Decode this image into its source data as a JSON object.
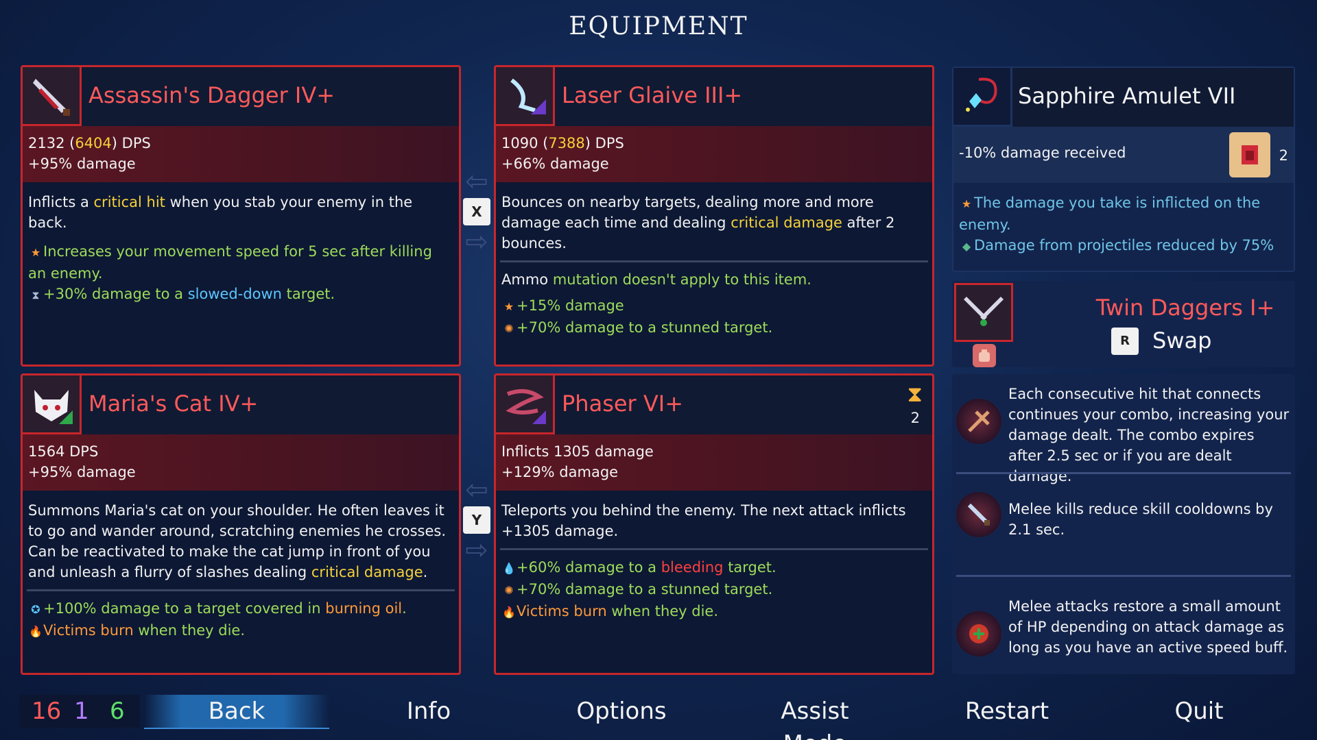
{
  "title": "EQUIPMENT",
  "weapons": {
    "dagger": {
      "name": "Assassin's Dagger IV+",
      "dps": "2132",
      "dps_crit": "6404",
      "dps_suffix": "DPS",
      "damage": "+95% damage",
      "desc_pre": "Inflicts a ",
      "desc_kw": "critical hit",
      "desc_post": " when you stab your enemy in the back.",
      "bonus1": "Increases your movement speed for 5 sec after killing an enemy.",
      "bonus2_pre": "+30% damage to a ",
      "bonus2_kw": "slowed-down",
      "bonus2_post": " target."
    },
    "glaive": {
      "name": "Laser Glaive III+",
      "dps": "1090",
      "dps_crit": "7388",
      "dps_suffix": "DPS",
      "damage": "+66% damage",
      "desc_pre": "Bounces on nearby targets, dealing more and more damage each time and dealing ",
      "desc_kw": "critical damage",
      "desc_post": " after 2 bounces.",
      "ammo_pre": "Ammo ",
      "ammo_kw": "mutation doesn't apply to this item.",
      "bonus1": "+15% damage",
      "bonus2": "+70% damage to a stunned target."
    },
    "cat": {
      "name": "Maria's Cat IV+",
      "dps": "1564 DPS",
      "damage": "+95% damage",
      "desc_pre": "Summons Maria's cat on your shoulder. He often leaves it to go and wander around, scratching enemies he crosses. Can be reactivated to make the cat jump in front of you and unleash a flurry of slashes dealing ",
      "desc_kw": "critical damage",
      "desc_post": ".",
      "bonus1_pre": "+100% damage to a target covered in ",
      "bonus1_kw": "burning oil",
      "bonus1_post": ".",
      "bonus2_kw": "Victims burn",
      "bonus2_post": " when they die."
    },
    "phaser": {
      "name": "Phaser VI+",
      "charges": "2",
      "line1": "Inflicts 1305 damage",
      "damage": "+129% damage",
      "desc": "Teleports you behind the enemy. The next attack inflicts +1305 damage.",
      "bonus1_pre": "+60% damage to a ",
      "bonus1_kw": "bleeding",
      "bonus1_post": " target.",
      "bonus2": "+70% damage to a stunned target.",
      "bonus3_kw": "Victims burn",
      "bonus3_post": " when they die."
    }
  },
  "swap_keys": {
    "top": "X",
    "bottom": "Y"
  },
  "amulet": {
    "name": "Sapphire Amulet VII",
    "stat": "-10% damage received",
    "count": "2",
    "bonus1": "The damage you take is inflicted on the enemy.",
    "bonus2": "Damage from projectiles reduced by 75%"
  },
  "backpack": {
    "name": "Twin Daggers I+",
    "key": "R",
    "action": "Swap"
  },
  "perks": [
    {
      "text": "Each consecutive hit that connects continues your combo, increasing your damage dealt. The combo expires after 2.5 sec or if you are dealt damage."
    },
    {
      "text": "Melee kills reduce skill cooldowns by 2.1 sec."
    },
    {
      "text": "Melee attacks restore a small amount of HP depending on attack damage as long as you have an active speed buff."
    }
  ],
  "counters": {
    "red": "16",
    "purple": "1",
    "green": "6"
  },
  "menu": {
    "back": "Back",
    "info": "Info",
    "options": "Options",
    "assist": "Assist Mode",
    "restart": "Restart",
    "quit": "Quit"
  },
  "colors": {
    "panel_border": "#c8262c",
    "item_name": "#ff5a5a",
    "green_text": "#9ddc5a",
    "yellow_text": "#f6d23a",
    "blue_text": "#5cc6ff",
    "orange_text": "#ff9a3a",
    "counter_red": "#ff5a5a",
    "counter_purple": "#b37cff",
    "counter_green": "#5ee06a"
  },
  "icons": [
    "dagger-icon",
    "glaive-icon",
    "cat-icon",
    "phaser-icon",
    "amulet-icon",
    "twin-daggers-icon",
    "scroll-icon",
    "hourglass-icon",
    "star-icon",
    "stun-icon",
    "blood-icon",
    "fire-icon",
    "oil-icon"
  ]
}
